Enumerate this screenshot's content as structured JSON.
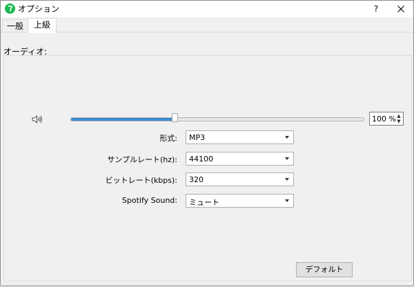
{
  "window": {
    "title": "オプション",
    "help_label": "?"
  },
  "tabs": [
    {
      "label": "一般",
      "selected": false
    },
    {
      "label": "上級",
      "selected": true
    }
  ],
  "audio": {
    "section_title": "オーディオ:",
    "volume": {
      "percent": 35.5,
      "display": "100 %"
    },
    "format": {
      "label": "形式:",
      "value": "MP3"
    },
    "sample_rate": {
      "label": "サンプルレート(hz):",
      "value": "44100"
    },
    "bitrate": {
      "label": "ビットレート(kbps):",
      "value": "320"
    },
    "spotify_sound": {
      "label": "Spotify Sound:",
      "value": "ミュート"
    }
  },
  "buttons": {
    "default_label": "デフォルト"
  },
  "colors": {
    "accent": "#3b8bd0",
    "app_icon": "#1db954"
  },
  "icons": {
    "app": "app-logo-icon",
    "speaker": "speaker-icon",
    "close": "close-icon"
  }
}
